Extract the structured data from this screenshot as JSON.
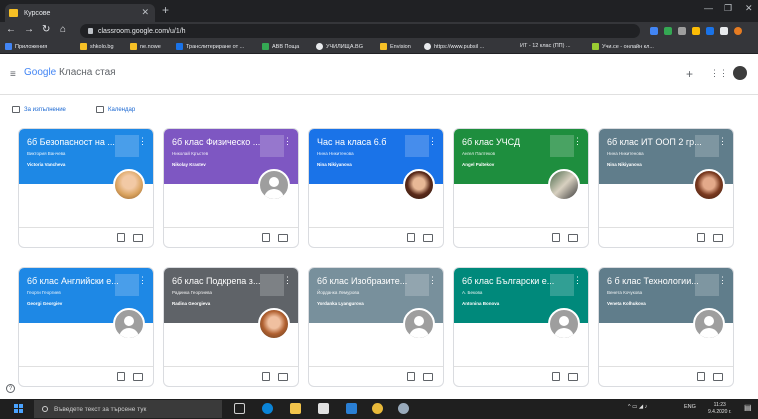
{
  "browser": {
    "tab_title": "Курсове",
    "url": "classroom.google.com/u/1/h",
    "bookmarks": [
      {
        "label": "Приложения",
        "color": "#4285f4"
      },
      {
        "label": "shkolo.bg",
        "color": "#f6c026"
      },
      {
        "label": "ne.nowe",
        "color": "#f6c026"
      },
      {
        "label": "Транслитериране от ...",
        "color": "#1a73e8"
      },
      {
        "label": "ABB Пощa",
        "color": "#34a853"
      },
      {
        "label": "УЧИЛИЩА.BG",
        "color": "#e8eaed"
      },
      {
        "label": "Envision",
        "color": "#f6c026"
      },
      {
        "label": "https://www.pubsil ...",
        "color": "#e8eaed"
      },
      {
        "label": "ИТ - 12 клас (ПП) ...",
        "color": "#e8eaed"
      },
      {
        "label": "Учи.се - онлайн кл...",
        "color": "#9acd32"
      }
    ]
  },
  "header": {
    "logo_google": "Google",
    "logo_product": "Класна стая"
  },
  "subnav": {
    "todo": "За изпълнение",
    "calendar": "Календар"
  },
  "courses": [
    {
      "title": "6б Безопасност на ...",
      "subtitle": "Виктория Ванчева",
      "teacher": "Victoria Vancheva",
      "color": "#1e88e5",
      "avatar": "photo1"
    },
    {
      "title": "6б клас Физическо ...",
      "subtitle": "Николай Кръстев",
      "teacher": "Nikolay Krastev",
      "color": "#7e57c2",
      "avatar": "gray"
    },
    {
      "title": "Час на класа 6.б",
      "subtitle": "Нина Никитенова",
      "teacher": "Nina Nikiyanova",
      "color": "#1a73e8",
      "avatar": "photo2"
    },
    {
      "title": "6б клас УЧСД",
      "subtitle": "Ангел Палтеков",
      "teacher": "Angel Paltekov",
      "color": "#1e8e3e",
      "avatar": "photo4"
    },
    {
      "title": "6б клас ИТ ООП 2 гр...",
      "subtitle": "Нина Никитенова",
      "teacher": "Nina Nikiyanova",
      "color": "#607d8b",
      "avatar": "photo3"
    },
    {
      "title": "6б клас Английски е...",
      "subtitle": "Георги Георгиев",
      "teacher": "Georgi Georgiev",
      "color": "#1e88e5",
      "avatar": "gray"
    },
    {
      "title": "6б клас Подкрепа з...",
      "subtitle": "Радинка Георгиева",
      "teacher": "Radina Georgieva",
      "color": "#5f6368",
      "avatar": "photo6"
    },
    {
      "title": "6б клас Изобразите...",
      "subtitle": "Йорданка Лемурова",
      "teacher": "Yordanka Lyangurova",
      "color": "#78909c",
      "avatar": "gray"
    },
    {
      "title": "6б клас Български е...",
      "subtitle": "А. Бекова",
      "teacher": "Antonina Bonova",
      "color": "#00897b",
      "avatar": "gray"
    },
    {
      "title": "6 б клас Технологии...",
      "subtitle": "Венета Кочукова",
      "teacher": "Veneta Kolhukova",
      "color": "#607d8b",
      "avatar": "gray"
    }
  ],
  "taskbar": {
    "search_placeholder": "Въведете текст за търсене тук",
    "lang": "ENG",
    "time": "11:23",
    "date": "9.4.2020 г."
  }
}
